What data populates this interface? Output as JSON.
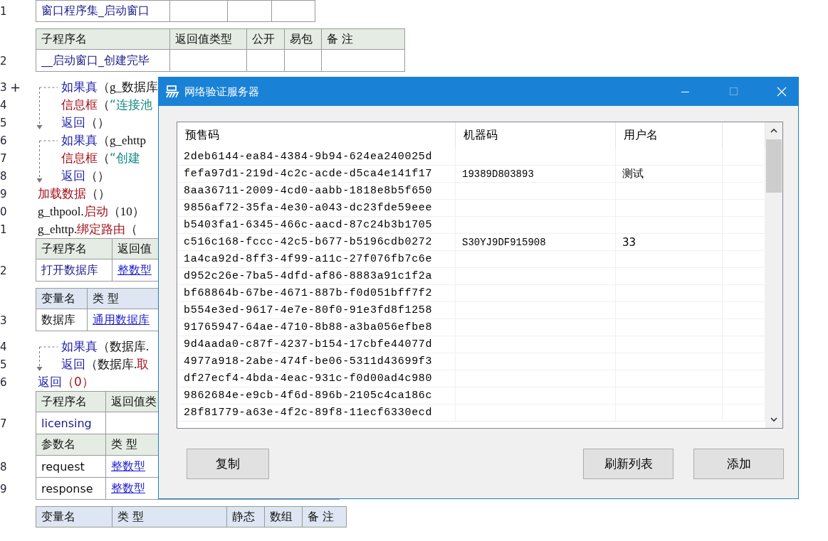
{
  "editor": {
    "blocks": [
      {
        "kind": "table",
        "rows": [
          {
            "line_no": "1",
            "kind": "row",
            "cells": [
              {
                "kind": "name",
                "text": "窗口程序集_启动窗口"
              },
              {
                "kind": "blank"
              },
              {
                "kind": "blank"
              },
              {
                "kind": "blank"
              }
            ]
          }
        ]
      },
      {
        "kind": "table",
        "rows": [
          {
            "kind": "header",
            "cells": [
              {
                "kind": "plain",
                "text": "子程序名"
              },
              {
                "kind": "plain",
                "text": "返回值类型"
              },
              {
                "kind": "plain",
                "text": "公开"
              },
              {
                "kind": "plain",
                "text": "易包"
              },
              {
                "kind": "plain",
                "text": "备 注"
              }
            ]
          },
          {
            "line_no": "2",
            "kind": "row",
            "cells": [
              {
                "kind": "name",
                "text": "__启动窗口_创建完毕"
              },
              {
                "kind": "blank"
              },
              {
                "kind": "blank"
              },
              {
                "kind": "blank"
              },
              {
                "kind": "blank"
              }
            ]
          }
        ]
      },
      {
        "kind": "flow",
        "lines": [
          {
            "line_no": "3",
            "marker": "+",
            "tokens": [
              {
                "kind": "keyword",
                "text": "如果真"
              },
              {
                "kind": "plain",
                "text": "（g_数据库"
              }
            ]
          },
          {
            "line_no": "4",
            "tokens": [
              {
                "kind": "command",
                "text": "信息框"
              },
              {
                "kind": "plain",
                "text": "（"
              },
              {
                "kind": "string",
                "text": "“连接池"
              }
            ]
          },
          {
            "line_no": "5",
            "tokens": [
              {
                "kind": "keyword",
                "text": "返回"
              },
              {
                "kind": "plain",
                "text": "（）"
              }
            ]
          }
        ]
      },
      {
        "kind": "flow",
        "lines": [
          {
            "line_no": "6",
            "tokens": [
              {
                "kind": "keyword",
                "text": "如果真"
              },
              {
                "kind": "plain",
                "text": "（g_ehttp"
              }
            ]
          },
          {
            "line_no": "7",
            "tokens": [
              {
                "kind": "command",
                "text": "信息框"
              },
              {
                "kind": "plain",
                "text": "（"
              },
              {
                "kind": "string",
                "text": "“创建"
              }
            ]
          },
          {
            "line_no": "8",
            "tokens": [
              {
                "kind": "keyword",
                "text": "返回"
              },
              {
                "kind": "plain",
                "text": "（）"
              }
            ]
          }
        ]
      },
      {
        "kind": "line",
        "line_no": "9",
        "tokens": [
          {
            "kind": "command",
            "text": "加载数据"
          },
          {
            "kind": "plain",
            "text": "（）"
          }
        ]
      },
      {
        "kind": "line",
        "line_no": "0",
        "tokens": [
          {
            "kind": "plain",
            "text": "g_thpool."
          },
          {
            "kind": "command",
            "text": "启动"
          },
          {
            "kind": "plain",
            "text": "（10）"
          }
        ]
      },
      {
        "kind": "line",
        "line_no": "1",
        "tokens": [
          {
            "kind": "plain",
            "text": "g_ehttp."
          },
          {
            "kind": "command",
            "text": "绑定路由"
          },
          {
            "kind": "plain",
            "text": "（"
          }
        ]
      },
      {
        "kind": "table",
        "rows": [
          {
            "kind": "header",
            "cells": [
              {
                "kind": "plain",
                "text": "子程序名"
              },
              {
                "kind": "plain",
                "text": "返回值"
              }
            ]
          },
          {
            "line_no": "2",
            "kind": "row",
            "cells": [
              {
                "kind": "name",
                "text": "打开数据库"
              },
              {
                "kind": "type",
                "text": "整数型"
              }
            ]
          }
        ]
      },
      {
        "kind": "table",
        "rows": [
          {
            "kind": "var_header",
            "cells": [
              {
                "kind": "plain",
                "text": "变量名"
              },
              {
                "kind": "plain",
                "text": "类 型"
              }
            ]
          },
          {
            "line_no": "3",
            "kind": "row",
            "cells": [
              {
                "kind": "plain",
                "text": "数据库"
              },
              {
                "kind": "type",
                "text": "通用数据库"
              }
            ]
          }
        ]
      },
      {
        "kind": "flow",
        "lines": [
          {
            "line_no": "4",
            "tokens": [
              {
                "kind": "keyword",
                "text": "如果真"
              },
              {
                "kind": "plain",
                "text": "（数据库."
              }
            ]
          },
          {
            "line_no": "5",
            "tokens": [
              {
                "kind": "keyword",
                "text": "返回"
              },
              {
                "kind": "plain",
                "text": "（数据库."
              },
              {
                "kind": "command",
                "text": "取"
              }
            ]
          }
        ]
      },
      {
        "kind": "line",
        "line_no": "6",
        "tokens": [
          {
            "kind": "keyword",
            "text": "返回"
          },
          {
            "kind": "number",
            "text": "（0）"
          }
        ]
      },
      {
        "kind": "table",
        "rows": [
          {
            "kind": "header",
            "cells": [
              {
                "kind": "plain",
                "text": "子程序名"
              },
              {
                "kind": "plain",
                "text": "返回值类"
              }
            ]
          },
          {
            "line_no": "7",
            "kind": "row",
            "cells": [
              {
                "kind": "name",
                "text": "licensing"
              },
              {
                "kind": "blank"
              }
            ]
          },
          {
            "kind": "header",
            "cells": [
              {
                "kind": "plain",
                "text": "参数名"
              },
              {
                "kind": "plain",
                "text": "类 型"
              }
            ]
          },
          {
            "line_no": "8",
            "kind": "row",
            "cells": [
              {
                "kind": "plain",
                "text": "request"
              },
              {
                "kind": "type",
                "text": "整数型"
              }
            ]
          },
          {
            "line_no": "9",
            "kind": "row",
            "cells": [
              {
                "kind": "plain",
                "text": "response"
              },
              {
                "kind": "type",
                "text": "整数型"
              },
              {
                "kind": "blank"
              },
              {
                "kind": "blank"
              },
              {
                "kind": "blank"
              },
              {
                "kind": "blank"
              }
            ]
          }
        ]
      },
      {
        "kind": "table",
        "rows": [
          {
            "kind": "var_header",
            "cells": [
              {
                "kind": "plain",
                "text": "变量名"
              },
              {
                "kind": "plain",
                "text": "类 型"
              },
              {
                "kind": "plain",
                "text": "静态"
              },
              {
                "kind": "plain",
                "text": "数组"
              },
              {
                "kind": "plain",
                "text": "备 注"
              }
            ]
          }
        ]
      }
    ]
  },
  "dialog": {
    "title": "网络验证服务器",
    "list": {
      "columns": [
        "预售码",
        "机器码",
        "用户名"
      ],
      "rows": [
        {
          "code": "2deb6144-ea84-4384-9b94-624ea240025d"
        },
        {
          "code": "fefa97d1-219d-4c2c-acde-d5ca4e141f17",
          "machine": "19389D803893",
          "user": "测试"
        },
        {
          "code": "8aa36711-2009-4cd0-aabb-1818e8b5f650"
        },
        {
          "code": "9856af72-35fa-4e30-a043-dc23fde59eee"
        },
        {
          "code": "b5403fa1-6345-466c-aacd-87c24b3b1705"
        },
        {
          "code": "c516c168-fccc-42c5-b677-b5196cdb0272",
          "machine": "S30YJ9DF915908",
          "user": "33"
        },
        {
          "code": "1a4ca92d-8ff3-4f99-a11c-27f076fb7c6e"
        },
        {
          "code": "d952c26e-7ba5-4dfd-af86-8883a91c1f2a"
        },
        {
          "code": "bf68864b-67be-4671-887b-f0d051bff7f2"
        },
        {
          "code": "b554e3ed-9617-4e7e-80f0-91e3fd8f1258"
        },
        {
          "code": "91765947-64ae-4710-8b88-a3ba056efbe8"
        },
        {
          "code": "9d4aada0-c87f-4237-b154-17cbfe44077d"
        },
        {
          "code": "4977a918-2abe-474f-be06-5311d43699f3"
        },
        {
          "code": "df27ecf4-4bda-4eac-931c-f0d00ad4c980"
        },
        {
          "code": "9862684e-e9cb-4f6d-896b-2105c4ca186c"
        },
        {
          "code": "28f81779-a63e-4f2c-89f8-11ecf6330ecd"
        }
      ]
    },
    "buttons": [
      {
        "label": "复制"
      },
      {
        "label": "刷新列表"
      },
      {
        "label": "添加"
      }
    ]
  }
}
